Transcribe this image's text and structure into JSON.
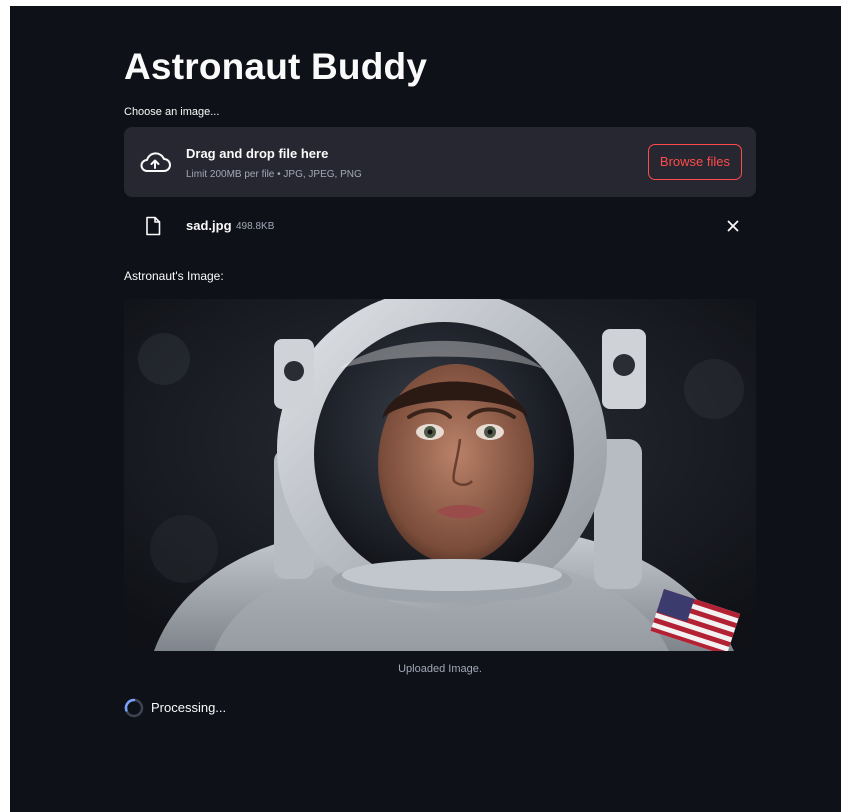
{
  "app": {
    "title": "Astronaut Buddy",
    "accent_color": "#ff4b4b",
    "background_color": "#0e1117"
  },
  "uploader": {
    "label": "Choose an image...",
    "drop_text": "Drag and drop file here",
    "limit_text": "Limit 200MB per file • JPG, JPEG, PNG",
    "browse_label": "Browse files",
    "icon": "cloud-upload-icon"
  },
  "uploaded_file": {
    "name": "sad.jpg",
    "size": "498.8KB",
    "icon": "file-icon",
    "remove_icon": "close-icon"
  },
  "image_section": {
    "heading": "Astronaut's Image:",
    "caption": "Uploaded Image."
  },
  "status": {
    "text": "Processing...",
    "icon": "spinner-icon"
  }
}
